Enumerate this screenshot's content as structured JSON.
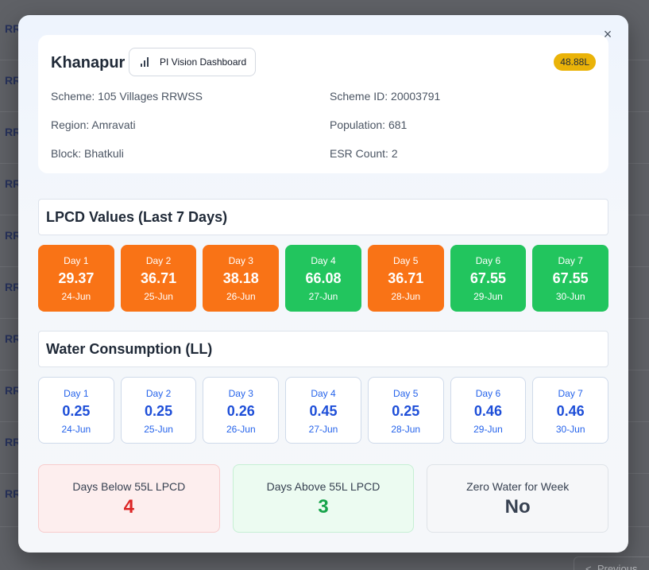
{
  "background": {
    "row_text": "RR",
    "pager_label": "Previous"
  },
  "modal": {
    "close_icon": "×",
    "village": "Khanapur",
    "pi_button_label": "PI Vision Dashboard",
    "lpcd_badge": "48.88L",
    "info": {
      "scheme": "Scheme: 105 Villages RRWSS",
      "scheme_id": "Scheme ID: 20003791",
      "region": "Region: Amravati",
      "population": "Population: 681",
      "block": "Block: Bhatkuli",
      "esr_count": "ESR Count: 2"
    },
    "lpcd_section": {
      "title": "LPCD Values (Last 7 Days)",
      "days": [
        {
          "label": "Day 1",
          "value": "29.37",
          "date": "24-Jun",
          "status": "orange"
        },
        {
          "label": "Day 2",
          "value": "36.71",
          "date": "25-Jun",
          "status": "orange"
        },
        {
          "label": "Day 3",
          "value": "38.18",
          "date": "26-Jun",
          "status": "orange"
        },
        {
          "label": "Day 4",
          "value": "66.08",
          "date": "27-Jun",
          "status": "green"
        },
        {
          "label": "Day 5",
          "value": "36.71",
          "date": "28-Jun",
          "status": "orange"
        },
        {
          "label": "Day 6",
          "value": "67.55",
          "date": "29-Jun",
          "status": "green"
        },
        {
          "label": "Day 7",
          "value": "67.55",
          "date": "30-Jun",
          "status": "green"
        }
      ]
    },
    "water_section": {
      "title": "Water Consumption (LL)",
      "days": [
        {
          "label": "Day 1",
          "value": "0.25",
          "date": "24-Jun"
        },
        {
          "label": "Day 2",
          "value": "0.25",
          "date": "25-Jun"
        },
        {
          "label": "Day 3",
          "value": "0.26",
          "date": "26-Jun"
        },
        {
          "label": "Day 4",
          "value": "0.45",
          "date": "27-Jun"
        },
        {
          "label": "Day 5",
          "value": "0.25",
          "date": "28-Jun"
        },
        {
          "label": "Day 6",
          "value": "0.46",
          "date": "29-Jun"
        },
        {
          "label": "Day 7",
          "value": "0.46",
          "date": "30-Jun"
        }
      ]
    },
    "summary": {
      "below": {
        "label": "Days Below 55L LPCD",
        "value": "4"
      },
      "above": {
        "label": "Days Above 55L LPCD",
        "value": "3"
      },
      "zero": {
        "label": "Zero Water for Week",
        "value": "No"
      }
    }
  },
  "colors": {
    "orange": "#f97316",
    "green": "#22c55e",
    "badge": "#eab308",
    "blue": "#1d4ed8"
  }
}
